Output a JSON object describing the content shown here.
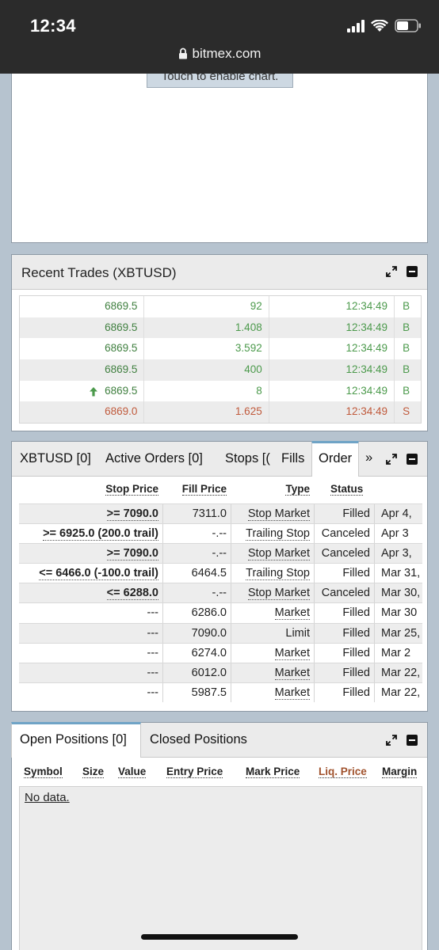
{
  "status_bar": {
    "time": "12:34",
    "url": "bitmex.com"
  },
  "chart": {
    "touch_label": "Touch to enable chart."
  },
  "recent_trades": {
    "title": "Recent Trades (XBTUSD)",
    "rows": [
      {
        "price": "6869.5",
        "size": "92",
        "time": "12:34:49",
        "side": "B",
        "dir": "buy"
      },
      {
        "price": "6869.5",
        "size": "1.408",
        "time": "12:34:49",
        "side": "B",
        "dir": "buy"
      },
      {
        "price": "6869.5",
        "size": "3.592",
        "time": "12:34:49",
        "side": "B",
        "dir": "buy"
      },
      {
        "price": "6869.5",
        "size": "400",
        "time": "12:34:49",
        "side": "B",
        "dir": "buy"
      },
      {
        "price": "6869.5",
        "size": "8",
        "time": "12:34:49",
        "side": "B",
        "dir": "buy"
      },
      {
        "price": "6869.0",
        "size": "1.625",
        "time": "12:34:49",
        "side": "S",
        "dir": "sell"
      }
    ]
  },
  "orders": {
    "tabs": [
      "XBTUSD [0]",
      "Active Orders [0]",
      "Stops [(",
      "Fills",
      "Order",
      "»"
    ],
    "columns": {
      "stop_price": "Stop Price",
      "fill_price": "Fill Price",
      "type": "Type",
      "status": "Status"
    },
    "rows": [
      {
        "stop": ">= 7090.0",
        "fill": "7311.0",
        "type": "Stop Market",
        "status": "Filled",
        "date": "Apr 4,"
      },
      {
        "stop": ">= 6925.0 (200.0 trail)",
        "fill": "-.--",
        "type": "Trailing Stop",
        "status": "Canceled",
        "date": "Apr 3"
      },
      {
        "stop": ">= 7090.0",
        "fill": "-.--",
        "type": "Stop Market",
        "status": "Canceled",
        "date": "Apr 3,"
      },
      {
        "stop": "<= 6466.0 (-100.0 trail)",
        "fill": "6464.5",
        "type": "Trailing Stop",
        "status": "Filled",
        "date": "Mar 31,"
      },
      {
        "stop": "<= 6288.0",
        "fill": "-.--",
        "type": "Stop Market",
        "status": "Canceled",
        "date": "Mar 30,"
      },
      {
        "stop": "---",
        "fill": "6286.0",
        "type": "Market",
        "status": "Filled",
        "date": "Mar 30"
      },
      {
        "stop": "---",
        "fill": "7090.0",
        "type": "Limit",
        "status": "Filled",
        "date": "Mar 25,"
      },
      {
        "stop": "---",
        "fill": "6274.0",
        "type": "Market",
        "status": "Filled",
        "date": "Mar 2"
      },
      {
        "stop": "---",
        "fill": "6012.0",
        "type": "Market",
        "status": "Filled",
        "date": "Mar 22,"
      },
      {
        "stop": "---",
        "fill": "5987.5",
        "type": "Market",
        "status": "Filled",
        "date": "Mar 22,"
      }
    ]
  },
  "positions": {
    "tabs": [
      "Open Positions [0]",
      "Closed Positions"
    ],
    "columns": [
      "Symbol",
      "Size",
      "Value",
      "Entry Price",
      "Mark Price",
      "Liq. Price",
      "Margin"
    ],
    "empty_text": "No data."
  }
}
